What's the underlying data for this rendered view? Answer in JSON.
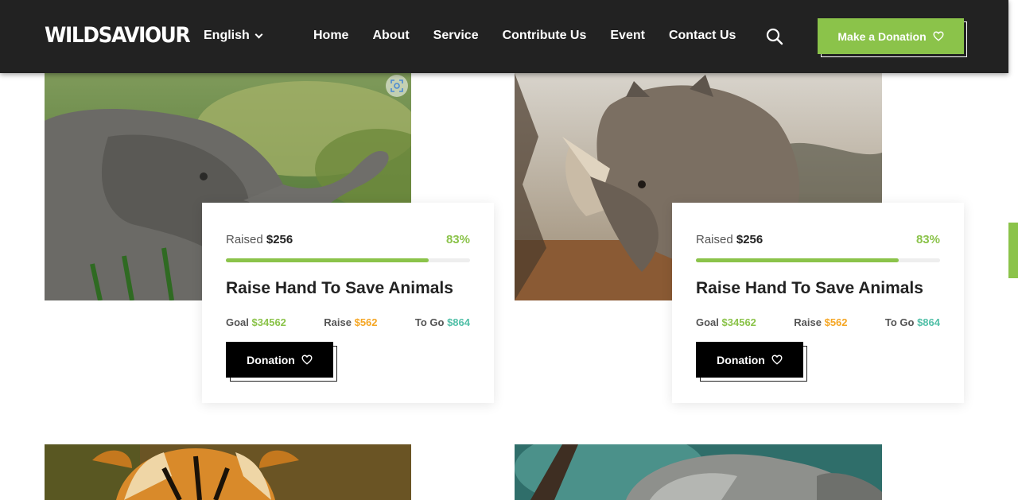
{
  "header": {
    "logo": "WILDSAVIOUR",
    "language": "English",
    "nav": [
      "Home",
      "About",
      "Service",
      "Contribute Us",
      "Event",
      "Contact Us"
    ],
    "donate_label": "Make a Donation"
  },
  "cards": [
    {
      "image": "elephant",
      "raised_label": "Raised",
      "raised_value": "$256",
      "percent": "83%",
      "progress": 0.83,
      "title": "Raise Hand To Save Animals",
      "goal_label": "Goal",
      "goal_value": "$34562",
      "raise_label": "Raise",
      "raise_value": "$562",
      "togo_label": "To Go",
      "togo_value": "$864",
      "button_label": "Donation"
    },
    {
      "image": "rhinoceros",
      "raised_label": "Raised",
      "raised_value": "$256",
      "percent": "83%",
      "progress": 0.83,
      "title": "Raise Hand To Save Animals",
      "goal_label": "Goal",
      "goal_value": "$34562",
      "raise_label": "Raise",
      "raise_value": "$562",
      "togo_label": "To Go",
      "togo_value": "$864",
      "button_label": "Donation"
    }
  ],
  "lower_images": [
    "tiger",
    "koala"
  ],
  "colors": {
    "accent": "#8bc34a",
    "header_bg": "#222222",
    "raise_value": "#f5a623",
    "togo_value": "#52c0a8"
  },
  "icons": [
    "search-icon",
    "heart-icon",
    "chevron-down-icon",
    "visual-search-icon"
  ]
}
